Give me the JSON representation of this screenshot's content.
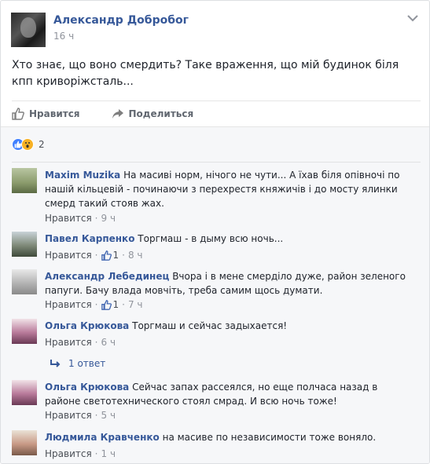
{
  "post": {
    "author": "Александр Добробог",
    "time": "16 ч",
    "text": "Хто знає, що воно смердить? Таке враження, що мій будинок біля кпп криворіжсталь...",
    "actions": {
      "like": "Нравится",
      "share": "Поделиться"
    },
    "reactions_count": "2"
  },
  "comments": [
    {
      "name": "Maxim Muzika",
      "text": "На масиві норм, нічого не чути... А їхав біля опівночі по нашій кільцевій - починаючи з перехрестя княжичів і до мосту ялинки смерд такий стояв жах.",
      "like_label": "Нравится",
      "time": "9 ч",
      "likes": ""
    },
    {
      "name": "Павел Карпенко",
      "text": "Торгмаш - в дыму всю ночь...",
      "like_label": "Нравится",
      "time": "8 ч",
      "likes": "1"
    },
    {
      "name": "Александр Лебединец",
      "text": "Вчора і в мене смерділо дуже, район зеленого папуги. Бачу влада мовчіть, треба самим щось думати.",
      "like_label": "Нравится",
      "time": "7 ч",
      "likes": "1"
    },
    {
      "name": "Ольга Крюкова",
      "text": "Торгмаш и сейчас задыхается!",
      "like_label": "Нравится",
      "time": "6 ч",
      "likes": ""
    },
    {
      "name": "Ольга Крюкова",
      "text": "Сейчас запах рассеялся, но еще полчаса назад в районе светотехнического стоял смрад. И всю ночь тоже!",
      "like_label": "Нравится",
      "time": "5 ч",
      "likes": ""
    },
    {
      "name": "Людмила Кравченко",
      "text": "на масиве по независимости тоже воняло.",
      "like_label": "Нравится",
      "time": "1 ч",
      "likes": ""
    }
  ],
  "reply_link": "1 ответ",
  "colors": {
    "link": "#365899",
    "meta": "#90949c",
    "bg_comments": "#f6f7f9"
  }
}
